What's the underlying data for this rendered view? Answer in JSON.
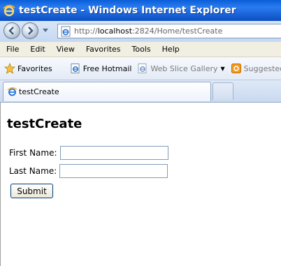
{
  "window": {
    "title": "testCreate - Windows Internet Explorer"
  },
  "address": {
    "prefix": "http://",
    "host": "localhost",
    "rest": ":2824/Home/testCreate"
  },
  "menu": {
    "items": [
      "File",
      "Edit",
      "View",
      "Favorites",
      "Tools",
      "Help"
    ]
  },
  "favorites": {
    "button_label": "Favorites",
    "links": [
      {
        "label": "Free Hotmail",
        "icon": "ie-page-icon"
      },
      {
        "label": "Web Slice Gallery",
        "icon": "web-slice-icon"
      },
      {
        "label": "Suggested Sites",
        "icon": "suggested-sites-icon"
      }
    ]
  },
  "tab": {
    "label": "testCreate"
  },
  "page": {
    "heading": "testCreate",
    "first_name_label": "First Name:",
    "first_name_value": "",
    "last_name_label": "Last Name:",
    "last_name_value": "",
    "submit_label": "Submit"
  },
  "colors": {
    "titlebar": "#0a5fd8",
    "address_border": "#7f9db9",
    "menubar": "#f1efe2",
    "button_border": "#003c74"
  }
}
